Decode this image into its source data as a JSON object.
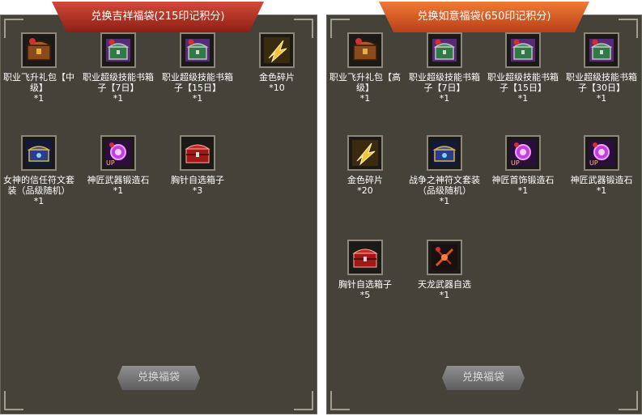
{
  "panels": [
    {
      "title": "兑换吉祥福袋(215印记积分)",
      "button": "兑换福袋",
      "items": [
        {
          "name": "职业飞升礼包【中级】",
          "qty": "*1",
          "icon": "chest-icon"
        },
        {
          "name": "职业超级技能书箱子【7日】",
          "qty": "*1",
          "icon": "skill-chest-icon"
        },
        {
          "name": "职业超级技能书箱子【15日】",
          "qty": "*1",
          "icon": "skill-chest-icon"
        },
        {
          "name": "金色碎片",
          "qty": "*10",
          "icon": "gold-shard-icon"
        },
        {
          "name": "女神的信任符文套装（品级随机）",
          "qty": "*1",
          "icon": "rune-chest-icon"
        },
        {
          "name": "神匠武器锻造石",
          "qty": "*1",
          "icon": "forge-stone-icon"
        },
        {
          "name": "胸针自选箱子",
          "qty": "*3",
          "icon": "brooch-chest-icon"
        }
      ]
    },
    {
      "title": "兑换如意福袋(650印记积分)",
      "button": "兑换福袋",
      "items": [
        {
          "name": "职业飞升礼包【高级】",
          "qty": "*1",
          "icon": "chest-icon"
        },
        {
          "name": "职业超级技能书箱子【7日】",
          "qty": "*1",
          "icon": "skill-chest-icon"
        },
        {
          "name": "职业超级技能书箱子【15日】",
          "qty": "*1",
          "icon": "skill-chest-icon"
        },
        {
          "name": "职业超级技能书箱子【30日】",
          "qty": "*1",
          "icon": "skill-chest-icon"
        },
        {
          "name": "金色碎片",
          "qty": "*20",
          "icon": "gold-shard-icon"
        },
        {
          "name": "战争之神符文套装（品级随机）",
          "qty": "*1",
          "icon": "rune-chest-icon"
        },
        {
          "name": "神匠首饰锻造石",
          "qty": "*1",
          "icon": "forge-stone-icon"
        },
        {
          "name": "神匠武器锻造石",
          "qty": "*1",
          "icon": "forge-stone-icon"
        },
        {
          "name": "胸针自选箱子",
          "qty": "*5",
          "icon": "brooch-chest-icon"
        },
        {
          "name": "天龙武器自选",
          "qty": "*1",
          "icon": "dragon-weapon-icon"
        }
      ]
    }
  ],
  "colors": {
    "panel_bg": "#45423a",
    "banner_red": "#b83424",
    "banner_orange": "#e2622a",
    "text": "#ffffff"
  }
}
